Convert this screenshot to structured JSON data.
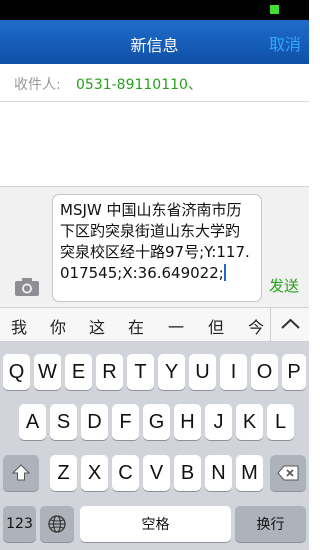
{
  "nav": {
    "title": "新信息",
    "cancel_label": "取消"
  },
  "recipient": {
    "label": "收件人:",
    "value": "0531-89110110、"
  },
  "compose": {
    "message_text": "MSJW 中国山东省济南市历下区趵突泉街道山东大学趵突泉校区经十路97号;Y:117.017545;X:36.649022;",
    "send_label": "发送",
    "camera_icon": "camera-icon"
  },
  "candidates": {
    "items": [
      "我",
      "你",
      "这",
      "在",
      "一",
      "但",
      "今"
    ],
    "expand_icon": "chevron-up-icon"
  },
  "keyboard": {
    "row1": [
      "Q",
      "W",
      "E",
      "R",
      "T",
      "Y",
      "U",
      "I",
      "O",
      "P"
    ],
    "row2": [
      "A",
      "S",
      "D",
      "F",
      "G",
      "H",
      "J",
      "K",
      "L"
    ],
    "row3": [
      "Z",
      "X",
      "C",
      "V",
      "B",
      "N",
      "M"
    ],
    "shift_icon": "shift-icon",
    "delete_icon": "delete-icon",
    "numbers_label": "123",
    "globe_icon": "globe-icon",
    "space_label": "空格",
    "return_label": "换行"
  },
  "colors": {
    "nav_bar": "#1257b5",
    "accent_green": "#27a11b",
    "cancel_blue": "#2fa7ff"
  }
}
